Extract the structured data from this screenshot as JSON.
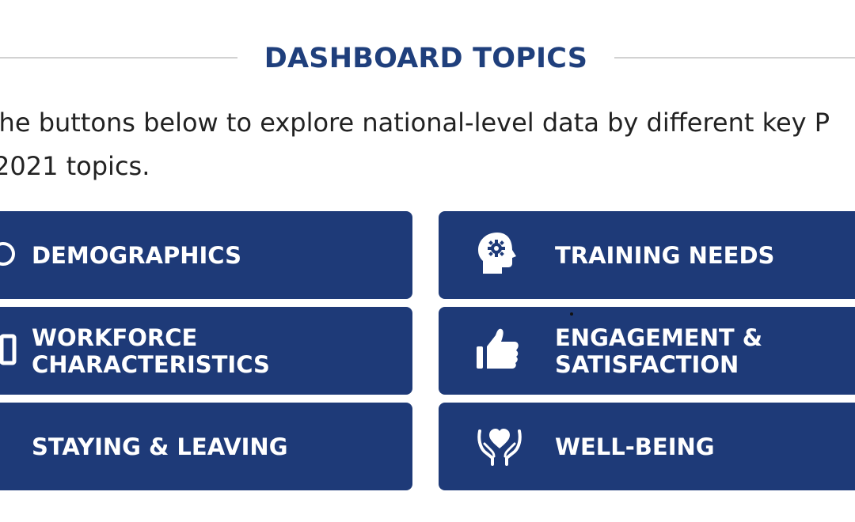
{
  "section": {
    "title": "DASHBOARD TOPICS",
    "intro_line1": "the buttons below to explore national-level data by different key P",
    "intro_line2": "2021 topics."
  },
  "topics": [
    {
      "label_lines": [
        "DEMOGRAPHICS"
      ],
      "icon": "person-icon"
    },
    {
      "label_lines": [
        "TRAINING NEEDS"
      ],
      "icon": "head-brain-icon"
    },
    {
      "label_lines": [
        "WORKFORCE",
        "CHARACTERISTICS"
      ],
      "icon": "briefcase-icon"
    },
    {
      "label_lines": [
        "ENGAGEMENT &",
        "SATISFACTION"
      ],
      "icon": "thumbs-up-icon"
    },
    {
      "label_lines": [
        "STAYING & LEAVING"
      ],
      "icon": "door-icon"
    },
    {
      "label_lines": [
        "WELL-BEING"
      ],
      "icon": "hands-heart-icon"
    }
  ],
  "colors": {
    "title": "#1f3f7c",
    "button_bg": "#1e3a78",
    "button_text": "#ffffff",
    "divider": "#d2d2d2",
    "body_text": "#222222"
  }
}
